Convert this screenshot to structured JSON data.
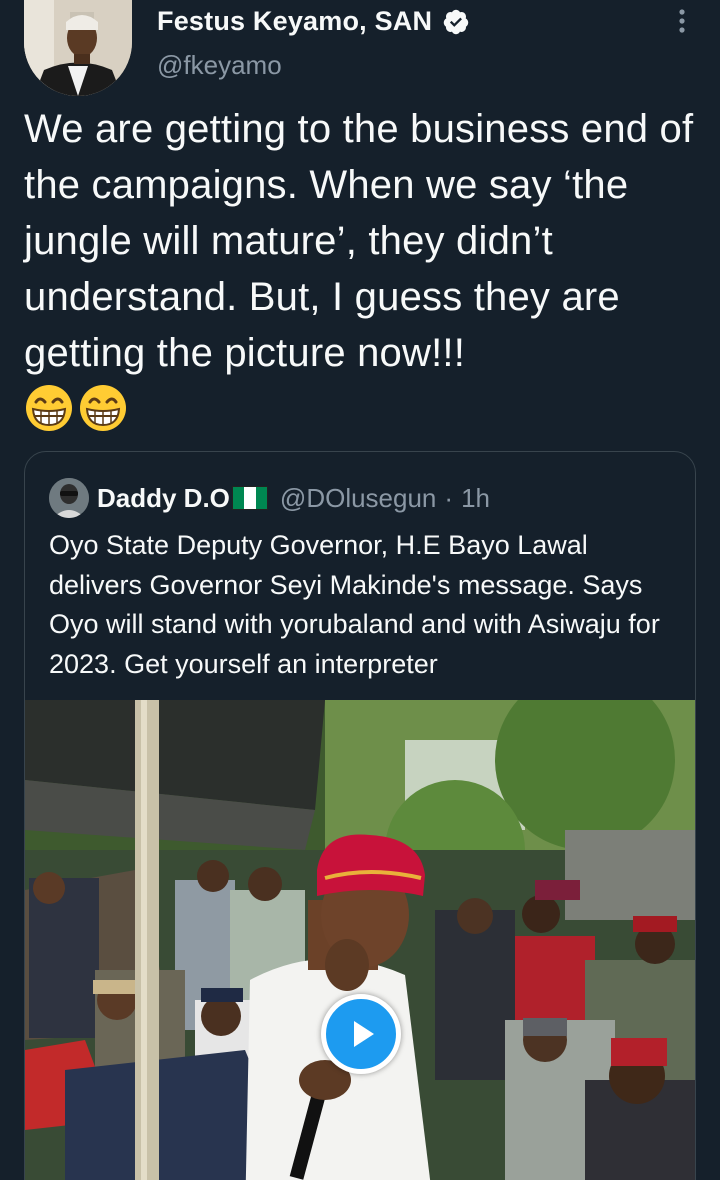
{
  "tweet": {
    "author": {
      "display_name": "Festus Keyamo, SAN",
      "handle": "@fkeyamo",
      "verified": true
    },
    "text": "We are getting to the business end of the campaigns. When we say ‘the jungle will mature’, they didn’t understand. But, I guess they are getting the picture now!!!",
    "emojis": [
      "grinning-face-with-smiling-eyes",
      "grinning-face-with-smiling-eyes"
    ]
  },
  "quoted_tweet": {
    "author": {
      "display_name": "Daddy D.O",
      "flag": "nigeria-flag",
      "handle": "@DOlusegun",
      "separator": "·",
      "time": "1h"
    },
    "text": "Oyo State Deputy Governor, H.E Bayo Lawal delivers Governor Seyi Makinde's message. Says Oyo will stand with yorubaland and with Asiwaju for 2023. Get yourself an interpreter",
    "media": {
      "type": "video",
      "icon": "play-icon"
    }
  },
  "colors": {
    "background": "#15202b",
    "text": "#f7f9f9",
    "secondary_text": "#8b98a5",
    "border": "#38444d",
    "accent": "#1d9bf0",
    "flag_green": "#008751"
  }
}
